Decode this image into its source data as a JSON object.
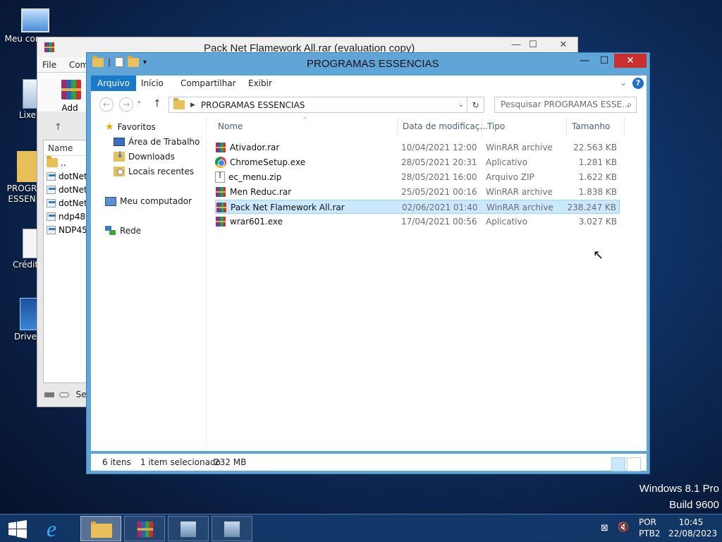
{
  "desktop": {
    "icons": [
      {
        "label": "Meu com"
      },
      {
        "label": "Lixe"
      },
      {
        "label": "PROGR ESSEN"
      },
      {
        "label": "Crédit"
      },
      {
        "label": "Drive"
      }
    ],
    "watermark_line1": "Windows 8.1 Pro",
    "watermark_line2": "Build 9600"
  },
  "rar_window": {
    "title": "Pack Net Flamework All.rar (evaluation copy)",
    "menu": [
      "File",
      "Com"
    ],
    "add_label": "Add",
    "list_header": "Name",
    "rows": [
      "..",
      "dotNet",
      "dotNet",
      "dotNet",
      "ndp48-",
      "NDP45"
    ],
    "status": "Sel"
  },
  "explorer": {
    "title": "PROGRAMAS ESSENCIAS",
    "tabs": [
      "Arquivo",
      "Início",
      "Compartilhar",
      "Exibir"
    ],
    "address": "PROGRAMAS ESSENCIAS",
    "search_placeholder": "Pesquisar PROGRAMAS ESSE...",
    "nav": {
      "favorites": "Favoritos",
      "desktop": "Área de Trabalho",
      "downloads": "Downloads",
      "recent": "Locais recentes",
      "computer": "Meu computador",
      "network": "Rede"
    },
    "columns": {
      "name": "Nome",
      "date": "Data de modificaç...",
      "type": "Tipo",
      "size": "Tamanho"
    },
    "files": [
      {
        "name": "Ativador.rar",
        "date": "10/04/2021 12:00",
        "type": "WinRAR archive",
        "size": "22.563 KB",
        "icon": "rar-icon"
      },
      {
        "name": "ChromeSetup.exe",
        "date": "28/05/2021 20:31",
        "type": "Aplicativo",
        "size": "1.281 KB",
        "icon": "chrome-icon"
      },
      {
        "name": "ec_menu.zip",
        "date": "28/05/2021 16:00",
        "type": "Arquivo ZIP",
        "size": "1.622 KB",
        "icon": "zip-icon"
      },
      {
        "name": "Men Reduc.rar",
        "date": "25/05/2021 00:16",
        "type": "WinRAR archive",
        "size": "1.838 KB",
        "icon": "rar-icon"
      },
      {
        "name": "Pack Net Flamework All.rar",
        "date": "02/06/2021 01:40",
        "type": "WinRAR archive",
        "size": "238.247 KB",
        "icon": "rar-icon"
      },
      {
        "name": "wrar601.exe",
        "date": "17/04/2021 00:56",
        "type": "Aplicativo",
        "size": "3.027 KB",
        "icon": "rar-icon"
      }
    ],
    "selected_index": 4,
    "status": {
      "count": "6 itens",
      "selection": "1 item selecionado",
      "size": "232 MB"
    }
  },
  "taskbar": {
    "lang_line1": "POR",
    "lang_line2": "PTB2",
    "time": "10:45",
    "date": "22/08/2023"
  }
}
